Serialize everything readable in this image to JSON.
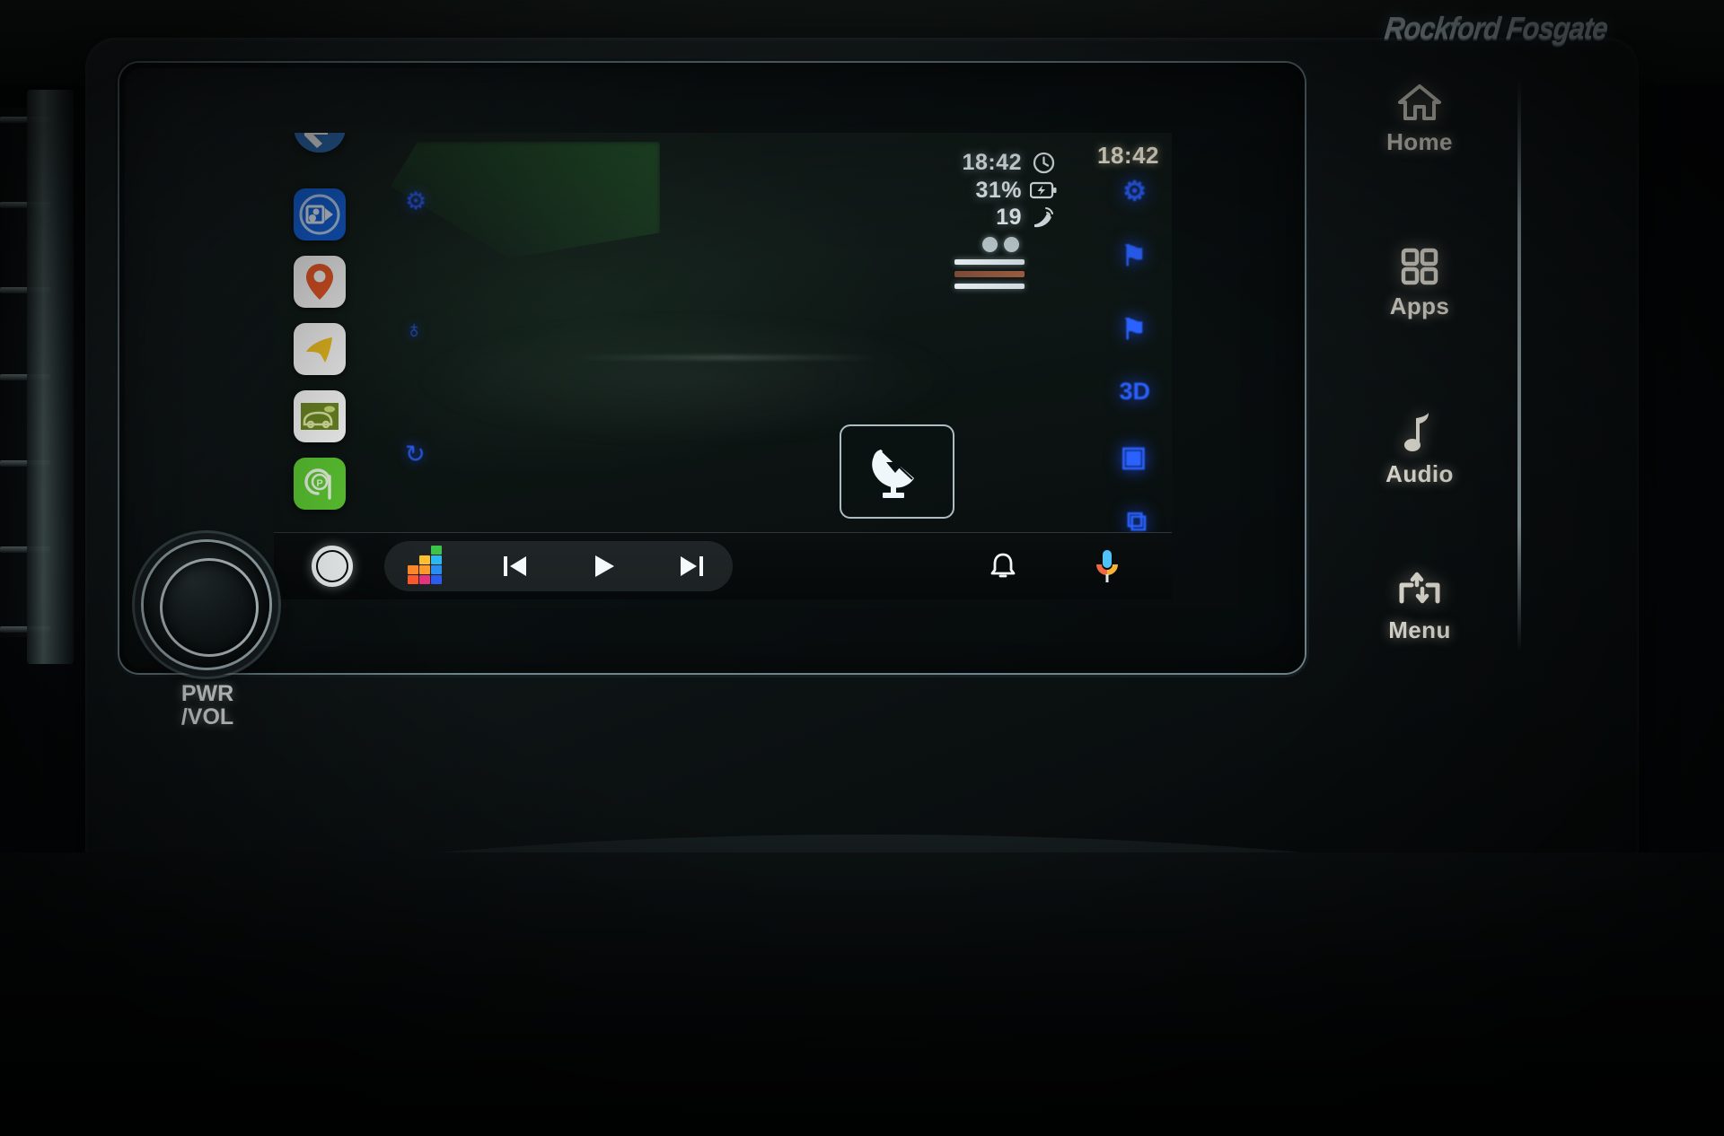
{
  "brand": {
    "badge": "Rockford Fosgate"
  },
  "hardware": {
    "knob_label_line1": "PWR",
    "knob_label_line2": "/VOL",
    "buttons": [
      {
        "name": "home",
        "label": "Home",
        "icon": "home-icon"
      },
      {
        "name": "apps",
        "label": "Apps",
        "icon": "grid-apps-icon"
      },
      {
        "name": "audio",
        "label": "Audio",
        "icon": "music-note-icon"
      },
      {
        "name": "menu",
        "label": "Menu",
        "icon": "menu-updown-arrows-icon"
      }
    ]
  },
  "screen": {
    "app_rail": [
      {
        "name": "waze-navigation",
        "icon": "waze-arrow-icon",
        "colors": {
          "bg": "#2f6fb8",
          "fg": "#ffffff"
        }
      },
      {
        "name": "media-player",
        "icon": "media-card-icon",
        "colors": {
          "bg": "#1565e0",
          "fg": "#d8ecff"
        }
      },
      {
        "name": "maps",
        "icon": "map-pin-icon",
        "colors": {
          "bg": "#ffffff",
          "fg": "#ef5b28"
        }
      },
      {
        "name": "navigation-arrow",
        "icon": "yellow-cursor-arrow-icon",
        "colors": {
          "bg": "#ffffff",
          "fg": "#f6c521"
        }
      },
      {
        "name": "dashcam",
        "icon": "dashcam-car-icon",
        "colors": {
          "bg": "#ffffff",
          "fg": "#6f8a25"
        }
      },
      {
        "name": "parking",
        "icon": "parking-p-icon",
        "colors": {
          "bg": "#5ecb33",
          "fg": "#e9f7e4"
        }
      }
    ],
    "ghost_icons": [
      {
        "name": "settings-gear-ghost",
        "glyph": "⚙"
      },
      {
        "name": "globe-ghost",
        "glyph": "♁"
      },
      {
        "name": "sync-ghost",
        "glyph": "↻"
      }
    ],
    "status": {
      "time": "18:42",
      "time_icon": "clock-icon",
      "battery": "31%",
      "battery_icon": "battery-charging-icon",
      "satellites": "19",
      "satellites_icon": "satellite-signal-icon"
    },
    "blue_column": {
      "clock": "18:42",
      "glyphs": [
        {
          "name": "bluetooth-settings-glyph",
          "glyph": "⚙"
        },
        {
          "name": "flag-glyph-1",
          "glyph": "⚑"
        },
        {
          "name": "flag-glyph-2",
          "glyph": "⚑"
        },
        {
          "name": "three-d-glyph",
          "glyph": "3D"
        },
        {
          "name": "window-glyph",
          "glyph": "▣"
        },
        {
          "name": "layers-glyph",
          "glyph": "⧉"
        }
      ]
    },
    "satellite_button": {
      "name": "satellite-dish-button",
      "icon": "satellite-dish-icon"
    },
    "dock": {
      "home_button": {
        "name": "assistant-home-circle",
        "icon": "circle-icon"
      },
      "source_icon": {
        "name": "deezer-equalizer-icon"
      },
      "controls": [
        {
          "name": "previous-track",
          "icon": "skip-previous-icon"
        },
        {
          "name": "play",
          "icon": "play-icon"
        },
        {
          "name": "next-track",
          "icon": "skip-next-icon"
        }
      ],
      "notifications": {
        "name": "notification-bell",
        "icon": "bell-icon"
      },
      "assistant": {
        "name": "google-assistant-mic",
        "icon": "microphone-icon"
      }
    }
  }
}
